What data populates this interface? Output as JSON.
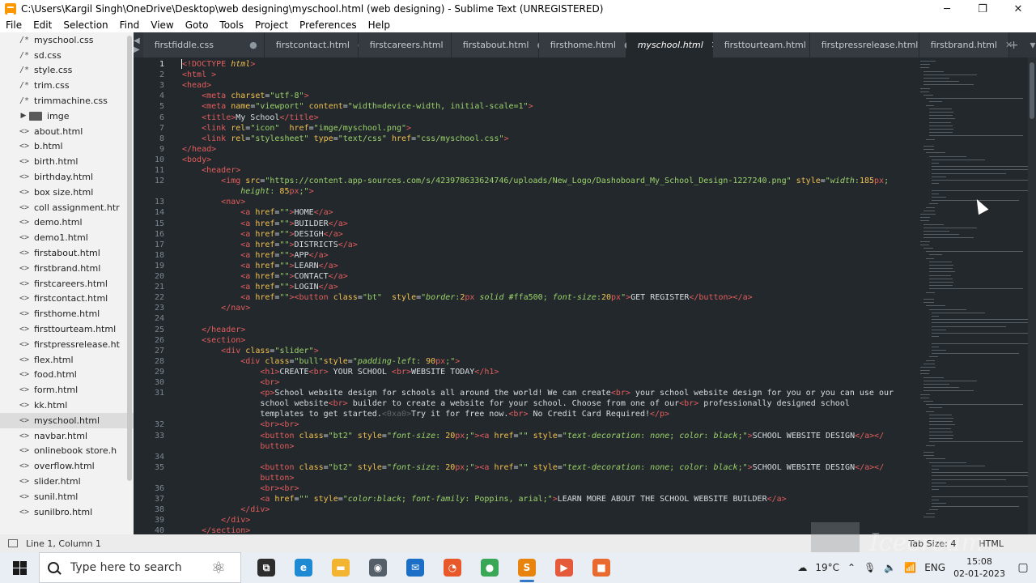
{
  "window": {
    "title": "C:\\Users\\Kargil Singh\\OneDrive\\Desktop\\web designing\\myschool.html (web designing) - Sublime Text (UNREGISTERED)",
    "controls": {
      "minimize": "─",
      "restore": "❐",
      "close": "✕"
    }
  },
  "menu": [
    "File",
    "Edit",
    "Selection",
    "Find",
    "View",
    "Goto",
    "Tools",
    "Project",
    "Preferences",
    "Help"
  ],
  "sidebar": {
    "items": [
      {
        "glyph": "/*",
        "label": "myschool.css"
      },
      {
        "glyph": "/*",
        "label": "sd.css"
      },
      {
        "glyph": "/*",
        "label": "style.css"
      },
      {
        "glyph": "/*",
        "label": "trim.css"
      },
      {
        "glyph": "/*",
        "label": "trimmachine.css"
      },
      {
        "glyph": "folder",
        "label": "imge"
      },
      {
        "glyph": "<>",
        "label": "about.html"
      },
      {
        "glyph": "<>",
        "label": "b.html"
      },
      {
        "glyph": "<>",
        "label": "birth.html"
      },
      {
        "glyph": "<>",
        "label": "birthday.html"
      },
      {
        "glyph": "<>",
        "label": "box size.html"
      },
      {
        "glyph": "<>",
        "label": "coll assignment.htr"
      },
      {
        "glyph": "<>",
        "label": "demo.html"
      },
      {
        "glyph": "<>",
        "label": "demo1.html"
      },
      {
        "glyph": "<>",
        "label": "firstabout.html"
      },
      {
        "glyph": "<>",
        "label": "firstbrand.html"
      },
      {
        "glyph": "<>",
        "label": "firstcareers.html"
      },
      {
        "glyph": "<>",
        "label": "firstcontact.html"
      },
      {
        "glyph": "<>",
        "label": "firsthome.html"
      },
      {
        "glyph": "<>",
        "label": "firsttourteam.html"
      },
      {
        "glyph": "<>",
        "label": "firstpressrelease.ht"
      },
      {
        "glyph": "<>",
        "label": "flex.html"
      },
      {
        "glyph": "<>",
        "label": "food.html"
      },
      {
        "glyph": "<>",
        "label": "form.html"
      },
      {
        "glyph": "<>",
        "label": "kk.html"
      },
      {
        "glyph": "<>",
        "label": "myschool.html",
        "selected": true
      },
      {
        "glyph": "<>",
        "label": "navbar.html"
      },
      {
        "glyph": "<>",
        "label": "onlinebook store.h"
      },
      {
        "glyph": "<>",
        "label": "overflow.html"
      },
      {
        "glyph": "<>",
        "label": "slider.html"
      },
      {
        "glyph": "<>",
        "label": "sunil.html"
      },
      {
        "glyph": "<>",
        "label": "sunilbro.html"
      }
    ]
  },
  "tabs": {
    "nav": "◀ ▶",
    "items": [
      {
        "label": "firstfiddle.css",
        "close": "●",
        "active": false
      },
      {
        "label": "firstcontact.html",
        "close": "●",
        "active": false
      },
      {
        "label": "firstcareers.html",
        "close": "●",
        "active": false
      },
      {
        "label": "firstabout.html",
        "close": "●",
        "active": false
      },
      {
        "label": "firsthome.html",
        "close": "●",
        "active": false
      },
      {
        "label": "myschool.html",
        "close": "✕",
        "active": true
      },
      {
        "label": "firsttourteam.html",
        "close": "●",
        "active": false
      },
      {
        "label": "firstpressrelease.html",
        "close": "✕",
        "active": false
      },
      {
        "label": "firstbrand.html",
        "close": "✕",
        "active": false
      }
    ],
    "new_tab": "+",
    "overflow": "▾"
  },
  "editor": {
    "lines": [
      {
        "n": "1",
        "y": 0,
        "h": "<span class=\"t\">&lt;!DOCTYPE</span> <span class=\"a it\">html</span><span class=\"t\">&gt;</span>"
      },
      {
        "n": "2",
        "y": 1,
        "h": "<span class=\"t\">&lt;html</span> <span class=\"t\">&gt;</span>"
      },
      {
        "n": "3",
        "y": 2,
        "h": "<span class=\"t\">&lt;head&gt;</span>"
      },
      {
        "n": "4",
        "y": 3,
        "h": "    <span class=\"t\">&lt;meta</span> <span class=\"a\">charset</span>=<span class=\"s\">\"utf-8\"</span><span class=\"t\">&gt;</span>"
      },
      {
        "n": "5",
        "y": 4,
        "h": "    <span class=\"t\">&lt;meta</span> <span class=\"a\">name</span>=<span class=\"s\">\"viewport\"</span> <span class=\"a\">content</span>=<span class=\"s\">\"width=device-width, initial-scale=1\"</span><span class=\"t\">&gt;</span>"
      },
      {
        "n": "6",
        "y": 5,
        "h": "    <span class=\"t\">&lt;title&gt;</span>My School<span class=\"t\">&lt;/title&gt;</span>"
      },
      {
        "n": "7",
        "y": 6,
        "h": "    <span class=\"t\">&lt;link</span> <span class=\"a\">rel</span>=<span class=\"s\">\"icon\"</span>  <span class=\"a\">href</span>=<span class=\"s\">\"imge/myschool.png\"</span><span class=\"t\">&gt;</span>"
      },
      {
        "n": "8",
        "y": 7,
        "h": "    <span class=\"t\">&lt;link</span> <span class=\"a\">rel</span>=<span class=\"s\">\"stylesheet\"</span> <span class=\"a\">type</span>=<span class=\"s\">\"text/css\"</span> <span class=\"a\">href</span>=<span class=\"s\">\"css/myschool.css\"</span><span class=\"t\">&gt;</span>"
      },
      {
        "n": "9",
        "y": 8,
        "h": "<span class=\"t\">&lt;/head&gt;</span>"
      },
      {
        "n": "10",
        "y": 9,
        "h": "<span class=\"t\">&lt;body&gt;</span>"
      },
      {
        "n": "11",
        "y": 10,
        "h": "    <span class=\"t\">&lt;header&gt;</span>"
      },
      {
        "n": "12",
        "y": 11,
        "h": "        <span class=\"t\">&lt;img</span> <span class=\"a\">src</span>=<span class=\"s\">\"https://content.app-sources.com/s/423978633624746/uploads/New_Logo/Dashoboard_My_School_Design-1227240.png\"</span> <span class=\"a\">style</span>=<span class=\"s\">\"<span class=\"it\">width</span>:<span class=\"a\">185</span><span class=\"t\">px</span>;</span>"
      },
      {
        "n": "",
        "y": 12,
        "h": "            <span class=\"s\"><span class=\"it\">height</span>: <span class=\"a\">85</span><span class=\"t\">px</span>;\"</span><span class=\"t\">&gt;</span>"
      },
      {
        "n": "13",
        "y": 13,
        "h": "        <span class=\"t\">&lt;nav&gt;</span>"
      },
      {
        "n": "14",
        "y": 14,
        "h": "            <span class=\"t\">&lt;a</span> <span class=\"a\">href</span>=<span class=\"s\">\"\"</span><span class=\"t\">&gt;</span>HOME<span class=\"t\">&lt;/a&gt;</span>"
      },
      {
        "n": "15",
        "y": 15,
        "h": "            <span class=\"t\">&lt;a</span> <span class=\"a\">href</span>=<span class=\"s\">\"\"</span><span class=\"t\">&gt;</span>BUILDER<span class=\"t\">&lt;/a&gt;</span>"
      },
      {
        "n": "16",
        "y": 16,
        "h": "            <span class=\"t\">&lt;a</span> <span class=\"a\">href</span>=<span class=\"s\">\"\"</span><span class=\"t\">&gt;</span>DESIGH<span class=\"t\">&lt;/a&gt;</span>"
      },
      {
        "n": "17",
        "y": 17,
        "h": "            <span class=\"t\">&lt;a</span> <span class=\"a\">href</span>=<span class=\"s\">\"\"</span><span class=\"t\">&gt;</span>DISTRICTS<span class=\"t\">&lt;/a&gt;</span>"
      },
      {
        "n": "18",
        "y": 18,
        "h": "            <span class=\"t\">&lt;a</span> <span class=\"a\">href</span>=<span class=\"s\">\"\"</span><span class=\"t\">&gt;</span>APP<span class=\"t\">&lt;/a&gt;</span>"
      },
      {
        "n": "19",
        "y": 19,
        "h": "            <span class=\"t\">&lt;a</span> <span class=\"a\">href</span>=<span class=\"s\">\"\"</span><span class=\"t\">&gt;</span>LEARN<span class=\"t\">&lt;/a&gt;</span>"
      },
      {
        "n": "20",
        "y": 20,
        "h": "            <span class=\"t\">&lt;a</span> <span class=\"a\">href</span>=<span class=\"s\">\"\"</span><span class=\"t\">&gt;</span>CONTACT<span class=\"t\">&lt;/a&gt;</span>"
      },
      {
        "n": "21",
        "y": 21,
        "h": "            <span class=\"t\">&lt;a</span> <span class=\"a\">href</span>=<span class=\"s\">\"\"</span><span class=\"t\">&gt;</span>LOGIN<span class=\"t\">&lt;/a&gt;</span>"
      },
      {
        "n": "22",
        "y": 22,
        "h": "            <span class=\"t\">&lt;a</span> <span class=\"a\">href</span>=<span class=\"s\">\"\"</span><span class=\"t\">&gt;&lt;button</span> <span class=\"a\">class</span>=<span class=\"s\">\"bt\"</span>  <span class=\"a\">style</span>=<span class=\"s\">\"<span class=\"it\">border</span>:<span class=\"a\">2</span><span class=\"t\">px</span> <span class=\"it\">solid</span> #ffa500; <span class=\"it\">font-size</span>:<span class=\"a\">20</span><span class=\"t\">px</span>\"</span><span class=\"t\">&gt;</span>GET REGISTER<span class=\"t\">&lt;/button&gt;&lt;/a&gt;</span>"
      },
      {
        "n": "23",
        "y": 23,
        "h": "        <span class=\"t\">&lt;/nav&gt;</span>"
      },
      {
        "n": "24",
        "y": 24,
        "h": ""
      },
      {
        "n": "25",
        "y": 25,
        "h": "    <span class=\"t\">&lt;/header&gt;</span>"
      },
      {
        "n": "26",
        "y": 26,
        "h": "    <span class=\"t\">&lt;section&gt;</span>"
      },
      {
        "n": "27",
        "y": 27,
        "h": "        <span class=\"t\">&lt;div</span> <span class=\"a\">class</span>=<span class=\"s\">\"slider\"</span><span class=\"t\">&gt;</span>"
      },
      {
        "n": "28",
        "y": 28,
        "h": "            <span class=\"t\">&lt;div</span> <span class=\"a\">class</span>=<span class=\"s\">\"bull\"</span><span class=\"a\">style</span>=<span class=\"s\">\"<span class=\"it\">padding-left</span>: <span class=\"a\">90</span><span class=\"t\">px</span>;\"</span><span class=\"t\">&gt;</span>"
      },
      {
        "n": "29",
        "y": 29,
        "h": "                <span class=\"t\">&lt;h1&gt;</span>CREATE<span class=\"t\">&lt;br&gt;</span> YOUR SCHOOL <span class=\"t\">&lt;br&gt;</span>WEBSITE TODAY<span class=\"t\">&lt;/h1&gt;</span>"
      },
      {
        "n": "30",
        "y": 30,
        "h": "                <span class=\"t\">&lt;br&gt;</span>"
      },
      {
        "n": "31",
        "y": 31,
        "h": "                <span class=\"t\">&lt;p&gt;</span>School website design for schools all around the world! We can create<span class=\"t\">&lt;br&gt;</span> your school website design for you or you can use our"
      },
      {
        "n": "",
        "y": 32,
        "h": "                school website<span class=\"t\">&lt;br&gt;</span> builder to create a website for your school. Choose from one of our<span class=\"t\">&lt;br&gt;</span> professionally designed school"
      },
      {
        "n": "",
        "y": 33,
        "h": "                templates to get started.<span style=\"color:#5d666d\">&lt;0xa0&gt;</span>Try it for free now.<span class=\"t\">&lt;br&gt;</span> No Credit Card Required!<span class=\"t\">&lt;/p&gt;</span>"
      },
      {
        "n": "32",
        "y": 34,
        "h": "                <span class=\"t\">&lt;br&gt;&lt;br&gt;</span>"
      },
      {
        "n": "33",
        "y": 35,
        "h": "                <span class=\"t\">&lt;button</span> <span class=\"a\">class</span>=<span class=\"s\">\"bt2\"</span> <span class=\"a\">style</span>=<span class=\"s\">\"<span class=\"it\">font-size</span>: <span class=\"a\">20</span><span class=\"t\">px</span>;\"</span><span class=\"t\">&gt;&lt;a</span> <span class=\"a\">href</span>=<span class=\"s\">\"\"</span> <span class=\"a\">style</span>=<span class=\"s\">\"<span class=\"it\">text-decoration</span>: <span class=\"it\">none</span>; <span class=\"it\">color</span>: <span class=\"it\">black</span>;\"</span><span class=\"t\">&gt;</span>SCHOOL WEBSITE DESIGN<span class=\"t\">&lt;/a&gt;&lt;/</span>"
      },
      {
        "n": "",
        "y": 36,
        "h": "                <span class=\"t\">button&gt;</span>"
      },
      {
        "n": "34",
        "y": 37,
        "h": ""
      },
      {
        "n": "35",
        "y": 38,
        "h": "                <span class=\"t\">&lt;button</span> <span class=\"a\">class</span>=<span class=\"s\">\"bt2\"</span> <span class=\"a\">style</span>=<span class=\"s\">\"<span class=\"it\">font-size</span>: <span class=\"a\">20</span><span class=\"t\">px</span>;\"</span><span class=\"t\">&gt;&lt;a</span> <span class=\"a\">href</span>=<span class=\"s\">\"\"</span> <span class=\"a\">style</span>=<span class=\"s\">\"<span class=\"it\">text-decoration</span>: <span class=\"it\">none</span>; <span class=\"it\">color</span>: <span class=\"it\">black</span>;\"</span><span class=\"t\">&gt;</span>SCHOOL WEBSITE DESIGN<span class=\"t\">&lt;/a&gt;&lt;/</span>"
      },
      {
        "n": "",
        "y": 39,
        "h": "                <span class=\"t\">button&gt;</span>"
      },
      {
        "n": "36",
        "y": 40,
        "h": "                <span class=\"t\">&lt;br&gt;&lt;br&gt;</span>"
      },
      {
        "n": "37",
        "y": 41,
        "h": "                <span class=\"t\">&lt;a</span> <span class=\"a\">href</span>=<span class=\"s\">\"\"</span> <span class=\"a\">style</span>=<span class=\"s\">\"<span class=\"it\">color</span>:<span class=\"it\">black</span>; <span class=\"it\">font-family</span>: Poppins, arial;\"</span><span class=\"t\">&gt;</span>LEARN MORE ABOUT THE SCHOOL WEBSITE BUILDER<span class=\"t\">&lt;/a&gt;</span>"
      },
      {
        "n": "38",
        "y": 42,
        "h": "            <span class=\"t\">&lt;/div&gt;</span>"
      },
      {
        "n": "39",
        "y": 43,
        "h": "        <span class=\"t\">&lt;/div&gt;</span>"
      },
      {
        "n": "40",
        "y": 44,
        "h": "    <span class=\"t\">&lt;/section&gt;</span>"
      }
    ]
  },
  "status": {
    "position": "Line 1, Column 1",
    "tab_size": "Tab Size: 4",
    "syntax": "HTML"
  },
  "watermark": "Icecream",
  "taskbar": {
    "search_placeholder": "Type here to search",
    "apps": [
      {
        "name": "task-view",
        "glyph": "⧉",
        "color": "#2d2d2d"
      },
      {
        "name": "edge",
        "glyph": "e",
        "color": "#1f8ad4"
      },
      {
        "name": "file-explorer",
        "glyph": "▬",
        "color": "#f3b531"
      },
      {
        "name": "camera",
        "glyph": "◉",
        "color": "#555f69"
      },
      {
        "name": "mail",
        "glyph": "✉",
        "color": "#1c6fc6"
      },
      {
        "name": "firefox",
        "glyph": "◔",
        "color": "#e8582b"
      },
      {
        "name": "chrome",
        "glyph": "●",
        "color": "#3aa757"
      },
      {
        "name": "sublime-text",
        "glyph": "S",
        "color": "#e8840e",
        "active": true
      },
      {
        "name": "icecream-recorder",
        "glyph": "▶",
        "color": "#e45a3b"
      },
      {
        "name": "screen-app",
        "glyph": "■",
        "color": "#e86a2e"
      }
    ],
    "weather": "19°C",
    "language": "ENG",
    "time": "15:08",
    "date": "02-01-2023",
    "notifications": "▢"
  }
}
